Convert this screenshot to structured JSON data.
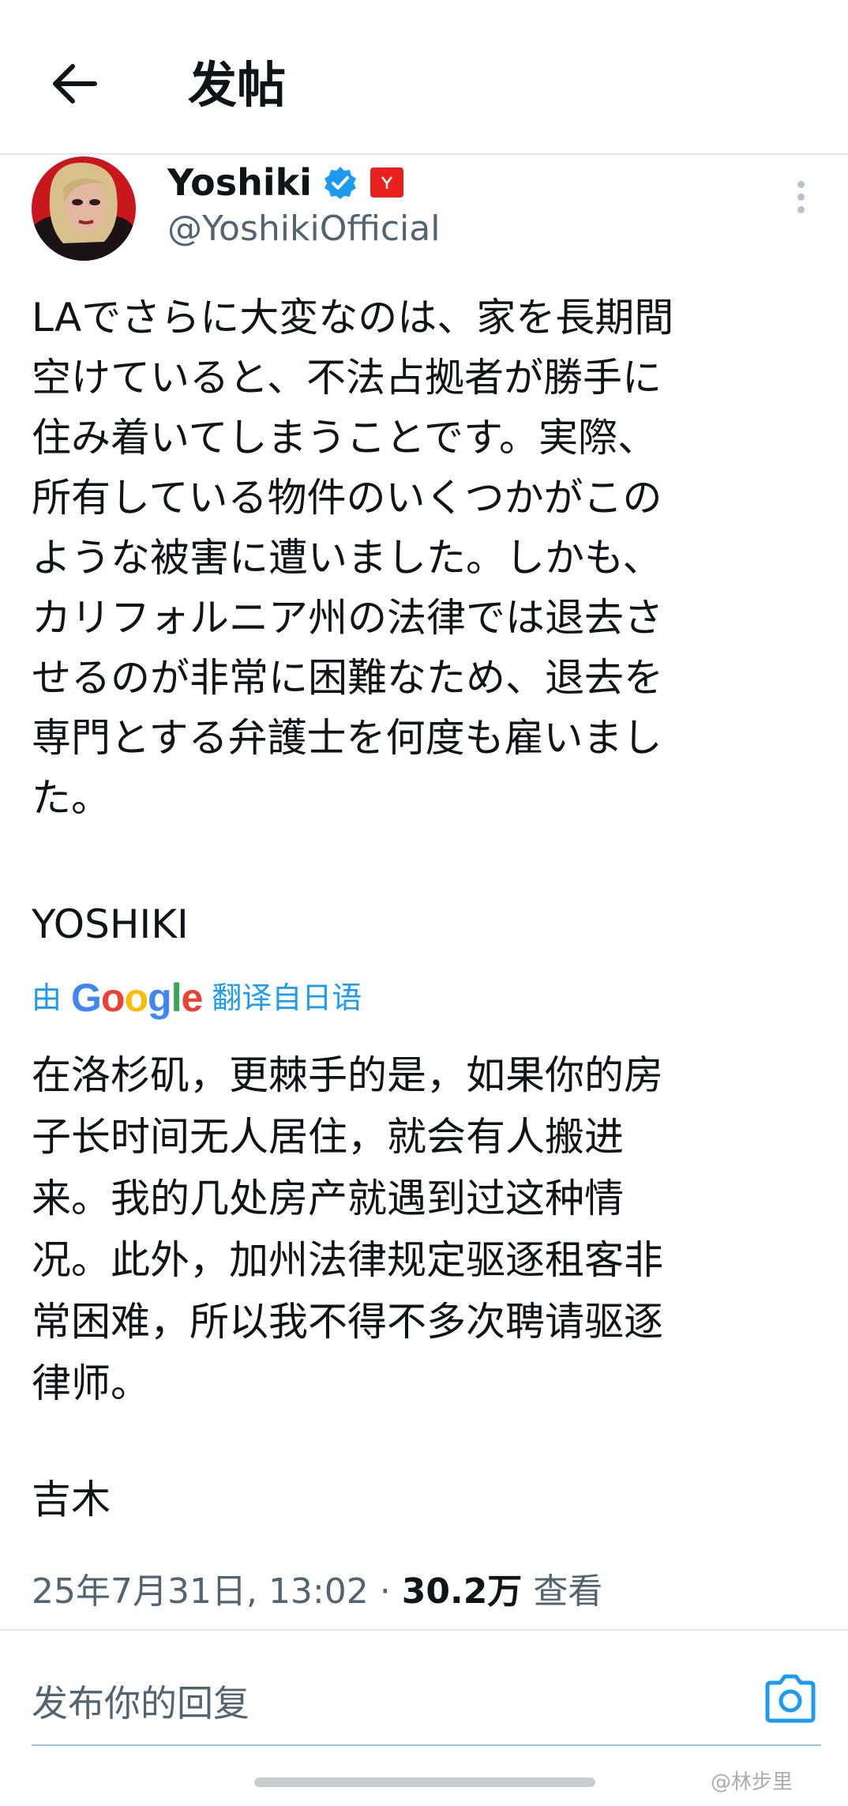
{
  "header": {
    "title": "发帖",
    "back_icon": "arrow-left-icon"
  },
  "author": {
    "display_name": "Yoshiki",
    "handle": "@YoshikiOfficial",
    "verified": true,
    "verified_color": "#1d9bf0",
    "affiliation_badge_color": "#e8201e"
  },
  "tweet": {
    "original_text": "LAでさらに大変なのは、家を長期間\n空けていると、不法占拠者が勝手に\n住み着いてしまうことです。実際、\n所有している物件のいくつかがこの\nような被害に遭いました。しかも、\nカリフォルニア州の法律では退去さ\nせるのが非常に困難なため、退去を\n専門とする弁護士を何度も雇いまし\nた。",
    "original_signature": "YOSHIKI",
    "translation_prefix": "由",
    "translation_brand": "Google",
    "translation_suffix": "翻译自日语",
    "translated_text": "在洛杉矶，更棘手的是，如果你的房\n子长时间无人居住，就会有人搬进\n来。我的几处房产就遇到过这种情\n况。此外，加州法律规定驱逐租客非\n常困难，所以我不得不多次聘请驱逐\n律师。",
    "translated_signature": "吉木"
  },
  "meta": {
    "timestamp": "25年7月31日, 13:02",
    "separator": "·",
    "views_count": "30.2万",
    "views_label": "查看"
  },
  "reply": {
    "placeholder": "发布你的回复",
    "camera_icon": "camera-icon"
  },
  "watermark": "@林步里",
  "colors": {
    "accent": "#1d9bf0",
    "text": "#0f1419",
    "secondary": "#536471",
    "divider": "#e6e9ec"
  }
}
